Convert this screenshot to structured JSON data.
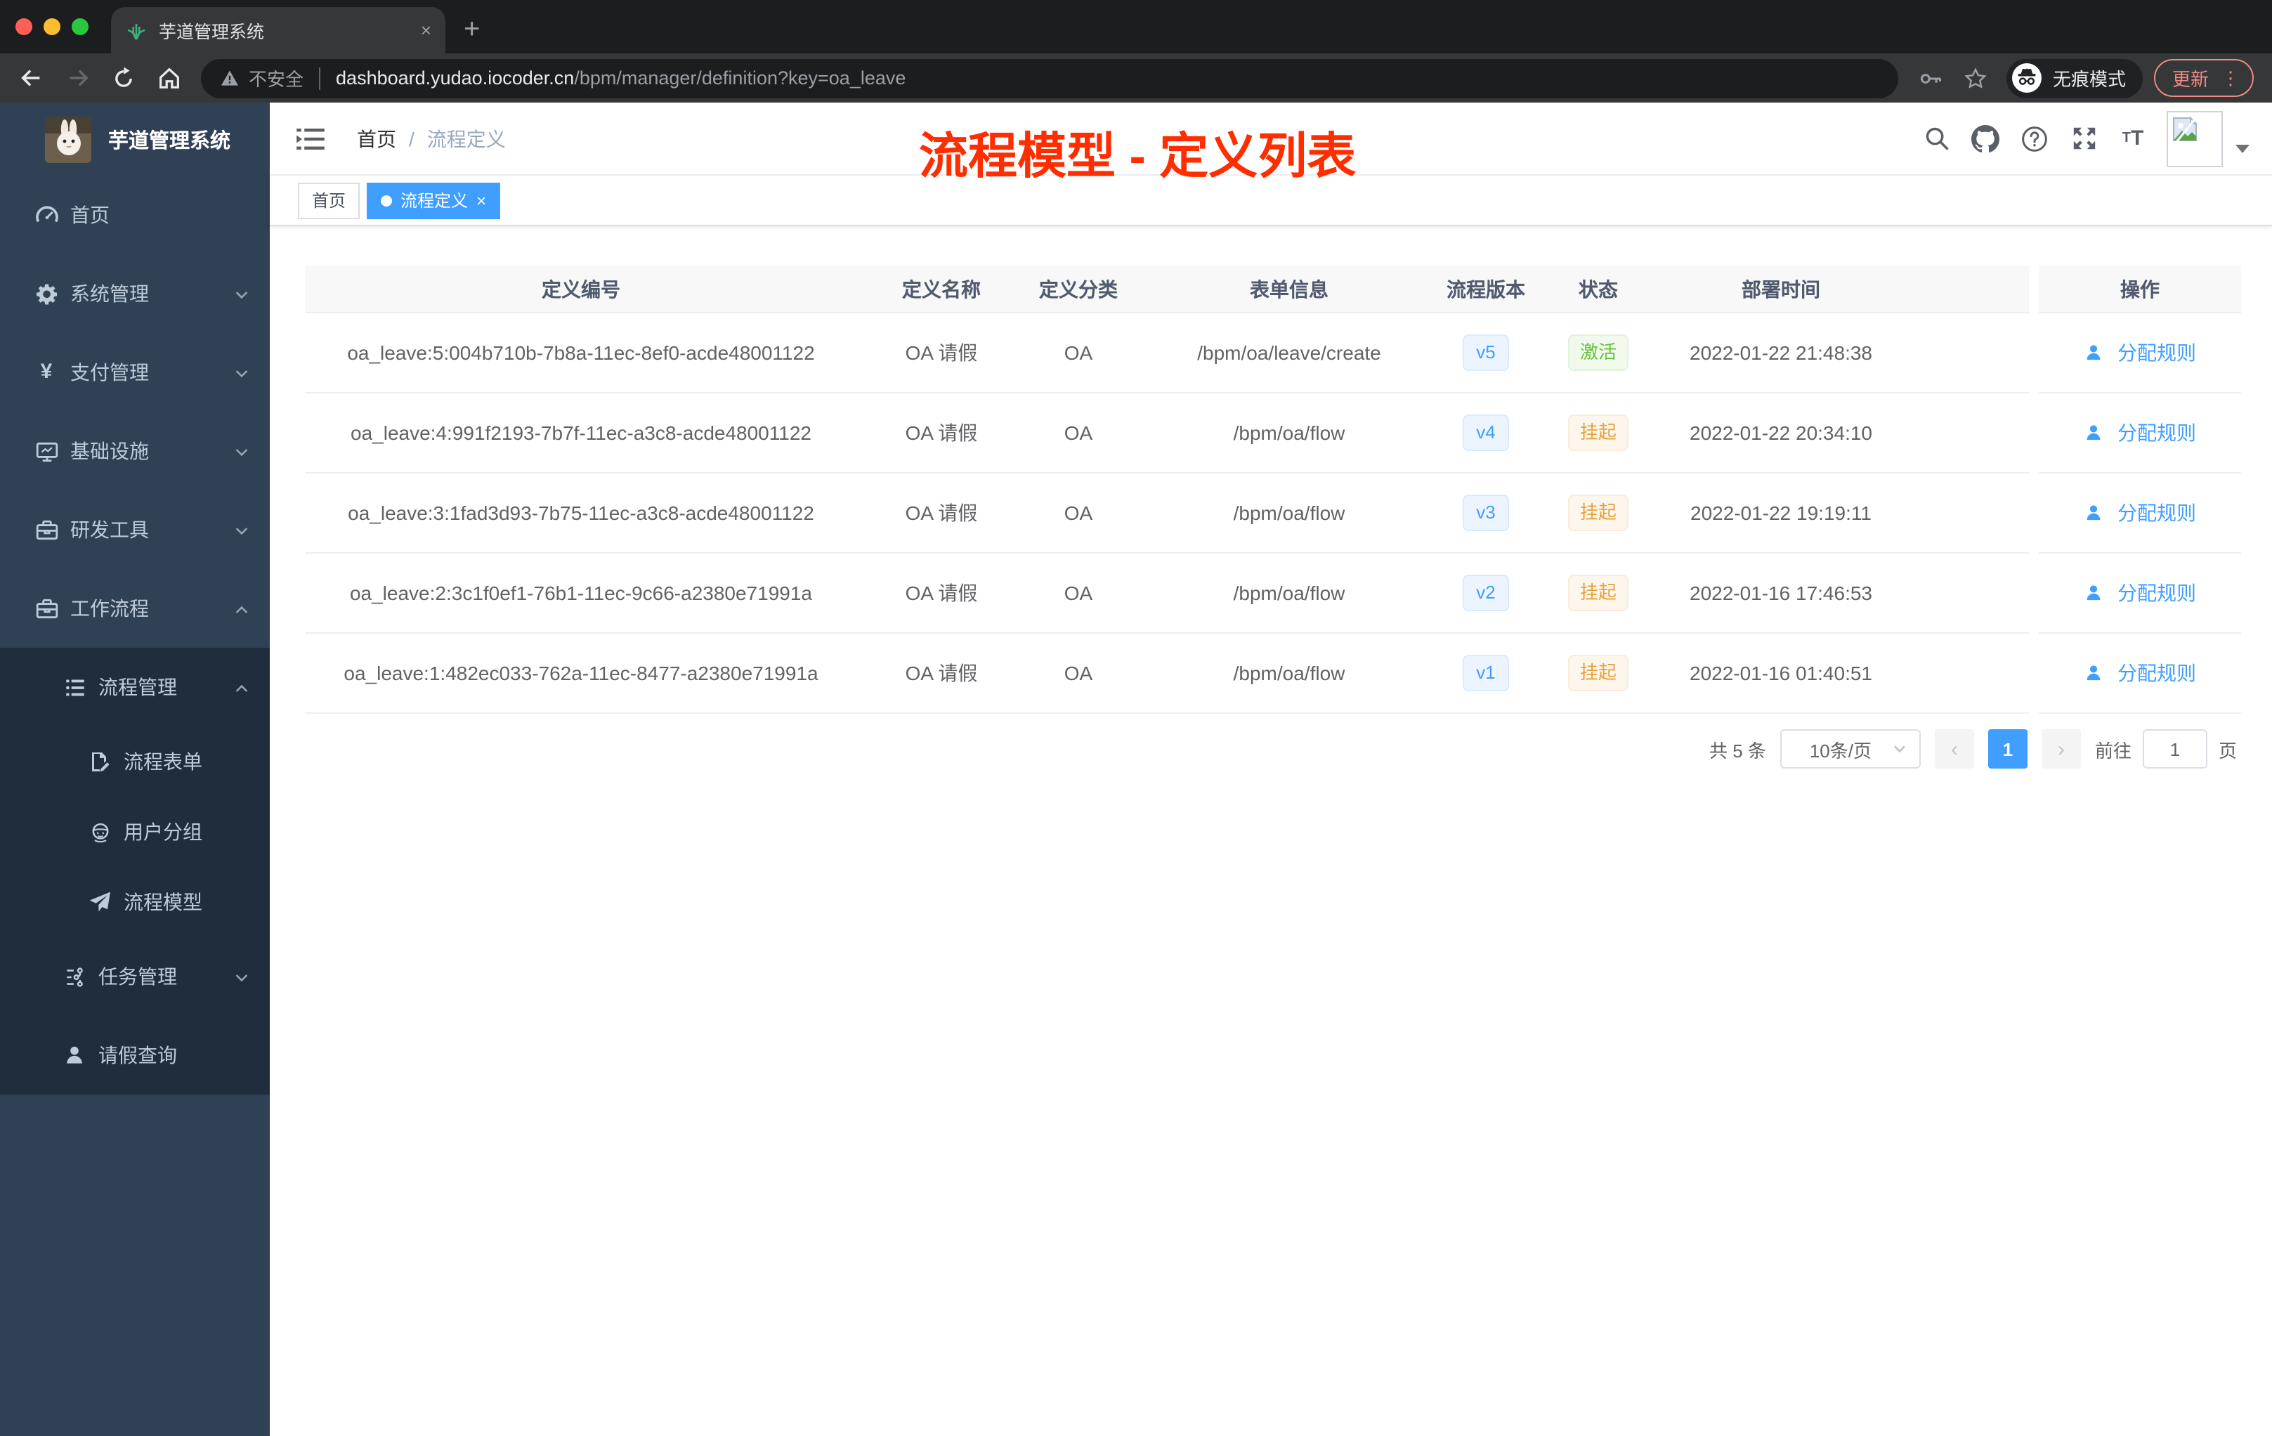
{
  "browser": {
    "tab": {
      "title": "芋道管理系统",
      "close_label": "×",
      "new_tab_label": "+"
    },
    "toolbar": {
      "security_label": "不安全",
      "url_host": "dashboard.yudao.iocoder.cn",
      "url_path": "/bpm/manager/definition?key=oa_leave",
      "incognito_label": "无痕模式",
      "update_label": "更新"
    }
  },
  "sidebar": {
    "logo_title": "芋道管理系统",
    "items": [
      {
        "label": "首页",
        "icon": "dashboard-icon",
        "level": 1,
        "chevron": null,
        "in_submenu": false
      },
      {
        "label": "系统管理",
        "icon": "gear-icon",
        "level": 1,
        "chevron": "down",
        "in_submenu": false
      },
      {
        "label": "支付管理",
        "icon": "yen-icon",
        "level": 1,
        "chevron": "down",
        "in_submenu": false
      },
      {
        "label": "基础设施",
        "icon": "monitor-icon",
        "level": 1,
        "chevron": "down",
        "in_submenu": false
      },
      {
        "label": "研发工具",
        "icon": "toolbox-icon",
        "level": 1,
        "chevron": "down",
        "in_submenu": false
      },
      {
        "label": "工作流程",
        "icon": "briefcase-icon",
        "level": 1,
        "chevron": "up",
        "in_submenu": false
      },
      {
        "label": "流程管理",
        "icon": "list-icon",
        "level": 2,
        "chevron": "up",
        "in_submenu": true
      },
      {
        "label": "流程表单",
        "icon": "form-icon",
        "level": 3,
        "chevron": null,
        "in_submenu": true
      },
      {
        "label": "用户分组",
        "icon": "user-group-icon",
        "level": 3,
        "chevron": null,
        "in_submenu": true
      },
      {
        "label": "流程模型",
        "icon": "paper-plane-icon",
        "level": 3,
        "chevron": null,
        "in_submenu": true
      },
      {
        "label": "任务管理",
        "icon": "tasks-icon",
        "level": 2,
        "chevron": "down",
        "in_submenu": true
      },
      {
        "label": "请假查询",
        "icon": "person-icon",
        "level": 2,
        "chevron": null,
        "in_submenu": true
      }
    ]
  },
  "header": {
    "breadcrumb": {
      "home": "首页",
      "separator": "/",
      "current": "流程定义"
    },
    "annotation": {
      "text": "流程模型 - 定义列表",
      "color": "#ff2d00"
    }
  },
  "tags_view": {
    "tags": [
      {
        "label": "首页",
        "active": false,
        "closable": false
      },
      {
        "label": "流程定义",
        "active": true,
        "closable": true,
        "close_label": "×"
      }
    ]
  },
  "table": {
    "columns": [
      "定义编号",
      "定义名称",
      "定义分类",
      "表单信息",
      "流程版本",
      "状态",
      "部署时间",
      "操作"
    ],
    "action_label": "分配规则",
    "rows": [
      {
        "id": "oa_leave:5:004b710b-7b8a-11ec-8ef0-acde48001122",
        "name": "OA 请假",
        "category": "OA",
        "form": "/bpm/oa/leave/create",
        "version": "v5",
        "status": "激活",
        "status_type": "success",
        "deploy_time": "2022-01-22 21:48:38"
      },
      {
        "id": "oa_leave:4:991f2193-7b7f-11ec-a3c8-acde48001122",
        "name": "OA 请假",
        "category": "OA",
        "form": "/bpm/oa/flow",
        "version": "v4",
        "status": "挂起",
        "status_type": "warning",
        "deploy_time": "2022-01-22 20:34:10"
      },
      {
        "id": "oa_leave:3:1fad3d93-7b75-11ec-a3c8-acde48001122",
        "name": "OA 请假",
        "category": "OA",
        "form": "/bpm/oa/flow",
        "version": "v3",
        "status": "挂起",
        "status_type": "warning",
        "deploy_time": "2022-01-22 19:19:11"
      },
      {
        "id": "oa_leave:2:3c1f0ef1-76b1-11ec-9c66-a2380e71991a",
        "name": "OA 请假",
        "category": "OA",
        "form": "/bpm/oa/flow",
        "version": "v2",
        "status": "挂起",
        "status_type": "warning",
        "deploy_time": "2022-01-16 17:46:53"
      },
      {
        "id": "oa_leave:1:482ec033-762a-11ec-8477-a2380e71991a",
        "name": "OA 请假",
        "category": "OA",
        "form": "/bpm/oa/flow",
        "version": "v1",
        "status": "挂起",
        "status_type": "warning",
        "deploy_time": "2022-01-16 01:40:51"
      }
    ]
  },
  "pagination": {
    "total_label": "共 5 条",
    "page_size": "10条/页",
    "current_page": "1",
    "prev_label": "‹",
    "next_label": "›",
    "goto_label": "前往",
    "goto_value": "1",
    "unit_label": "页"
  },
  "colors": {
    "primary": "#409eff",
    "success": "#67c23a",
    "warning": "#e6a23c",
    "sidebar_bg": "#304156",
    "sidebar_submenu_bg": "#1f2d3d",
    "active_tag_bg": "#409eff",
    "annotation_red": "#ff2d00",
    "version_tag_bg": "#ecf5ff",
    "status_success_bg": "#f0f9eb",
    "status_warning_bg": "#fdf6ec"
  }
}
